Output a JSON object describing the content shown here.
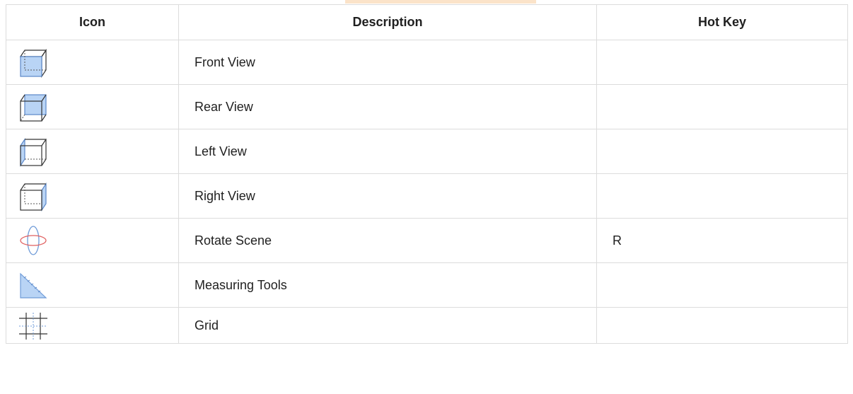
{
  "table": {
    "headers": {
      "icon": "Icon",
      "description": "Description",
      "hotkey": "Hot Key"
    },
    "rows": [
      {
        "icon": "front-view-icon",
        "description": "Front View",
        "hotkey": ""
      },
      {
        "icon": "rear-view-icon",
        "description": "Rear View",
        "hotkey": ""
      },
      {
        "icon": "left-view-icon",
        "description": "Left View",
        "hotkey": ""
      },
      {
        "icon": "right-view-icon",
        "description": "Right View",
        "hotkey": ""
      },
      {
        "icon": "rotate-scene-icon",
        "description": "Rotate Scene",
        "hotkey": "R"
      },
      {
        "icon": "measuring-tools-icon",
        "description": "Measuring Tools",
        "hotkey": ""
      },
      {
        "icon": "grid-icon",
        "description": "Grid",
        "hotkey": ""
      }
    ]
  },
  "colors": {
    "accent_fill": "#b9d4f5",
    "accent_stroke": "#6f9bd8",
    "rotate_red": "#e06060",
    "border": "#dcdcdc"
  }
}
